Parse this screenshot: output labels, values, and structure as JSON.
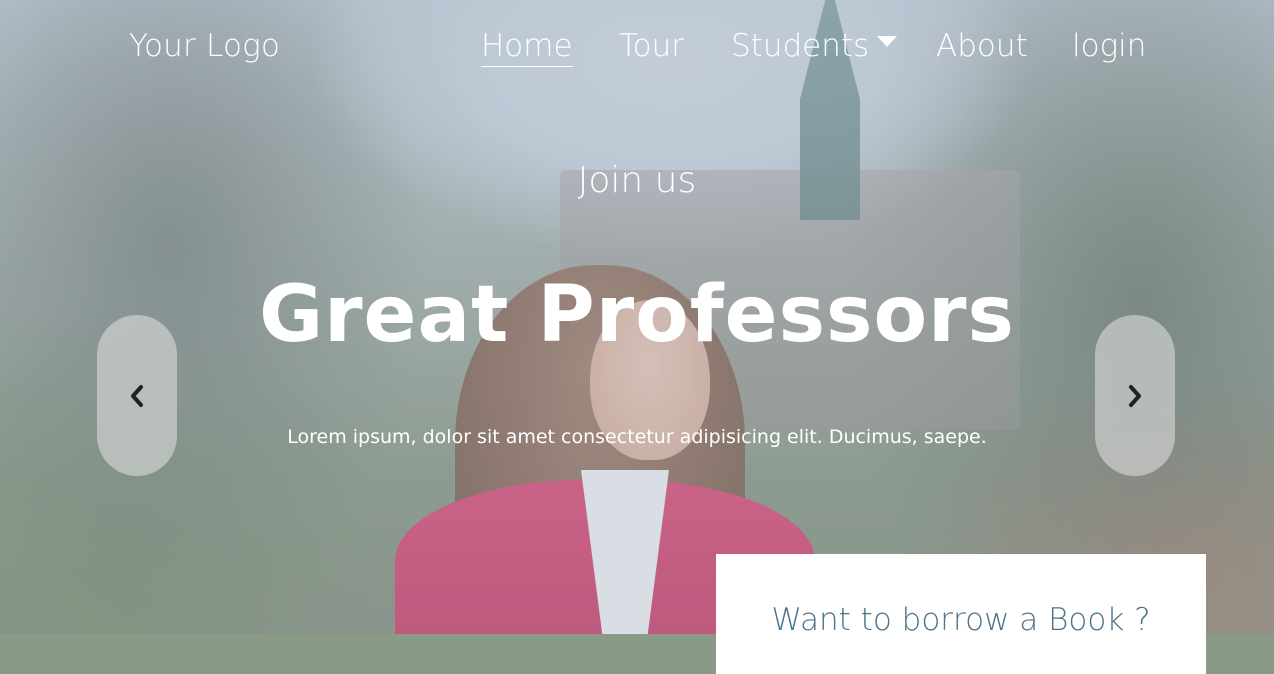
{
  "nav": {
    "logo": "Your Logo",
    "items": [
      {
        "label": "Home",
        "active": true
      },
      {
        "label": "Tour"
      },
      {
        "label": "Students",
        "has_dropdown": true
      },
      {
        "label": "About"
      },
      {
        "label": "login"
      }
    ]
  },
  "hero": {
    "tagline": "Join us",
    "title": "Great Professors",
    "subtitle": "Lorem ipsum, dolor sit amet consectetur adipisicing elit. Ducimus, saepe."
  },
  "carousel": {
    "prev_icon": "chevron-left-icon",
    "next_icon": "chevron-right-icon"
  },
  "book_card": {
    "title": "Want to borrow a Book ?"
  },
  "colors": {
    "nav_text": "#ffffff",
    "card_title": "#4d7289",
    "card_bg": "#ffffff"
  }
}
